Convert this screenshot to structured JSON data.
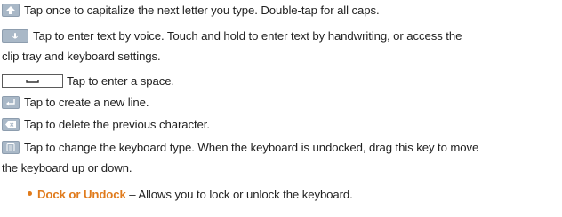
{
  "items": [
    {
      "icon": "shift-arrow-icon",
      "text": "Tap once to capitalize the next letter you type. Double-tap for all caps."
    },
    {
      "icon": "microphone-icon",
      "text": "Tap to enter text by voice. Touch and hold to enter text by handwriting, or access the",
      "text_cont": "clip tray and keyboard settings."
    },
    {
      "icon": "space-bar-icon",
      "text": "Tap to enter a space."
    },
    {
      "icon": "enter-icon",
      "text": "Tap to create a new line."
    },
    {
      "icon": "delete-icon",
      "text": "Tap to delete the previous character."
    },
    {
      "icon": "keyboard-type-icon",
      "text": "Tap to change the keyboard type. When the keyboard is undocked, drag this key to move",
      "text_cont": "the keyboard up or down."
    }
  ],
  "bullet": {
    "title": "Dock or Undock",
    "separator": " – ",
    "text": "Allows you to lock or unlock the keyboard."
  },
  "colors": {
    "accent": "#e07b1c",
    "key_fill": "#a9b8c7",
    "text": "#1f1f1f"
  }
}
